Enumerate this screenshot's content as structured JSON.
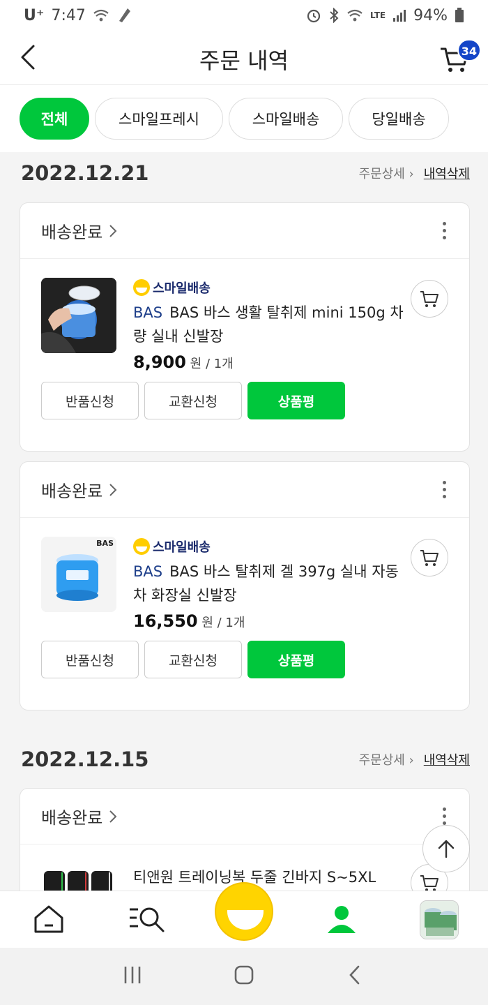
{
  "status_bar": {
    "carrier": "U⁺",
    "time": "7:47",
    "lte": "LTE",
    "battery": "94%"
  },
  "header": {
    "title": "주문 내역",
    "cart_count": "34"
  },
  "filters": [
    "전체",
    "스마일프레시",
    "스마일배송",
    "당일배송"
  ],
  "groups": [
    {
      "date": "2022.12.21",
      "detail_link": "주문상세 ›",
      "delete_link": "내역삭제",
      "orders": [
        {
          "status": "배송완료",
          "badge": "스마일배송",
          "brand": "BAS",
          "name": "BAS 바스 생활 탈취제 mini 150g 차량 실내 신발장",
          "price": "8,900",
          "unit": "원 / 1개",
          "buttons": [
            "반품신청",
            "교환신청",
            "상품평"
          ]
        },
        {
          "status": "배송완료",
          "badge": "스마일배송",
          "brand": "BAS",
          "name": "BAS 바스 탈취제 겔 397g 실내 자동차 화장실 신발장",
          "price": "16,550",
          "unit": "원 / 1개",
          "buttons": [
            "반품신청",
            "교환신청",
            "상품평"
          ]
        }
      ]
    },
    {
      "date": "2022.12.15",
      "detail_link": "주문상세 ›",
      "delete_link": "내역삭제",
      "orders": [
        {
          "status": "배송완료",
          "name": "티앤원 트레이닝복 두줄 긴바지 S~5XL"
        }
      ]
    }
  ],
  "thumb_labels": {
    "bas_logo": "BAS"
  },
  "colors": {
    "accent_green": "#00c73c",
    "smile_yellow": "#ffcd00",
    "badge_blue": "#1445c8"
  },
  "icons": [
    "back-arrow-icon",
    "cart-icon",
    "chevron-right-icon",
    "more-vertical-icon",
    "arrow-up-icon",
    "home-icon",
    "search-list-icon",
    "smile-icon",
    "person-icon"
  ]
}
